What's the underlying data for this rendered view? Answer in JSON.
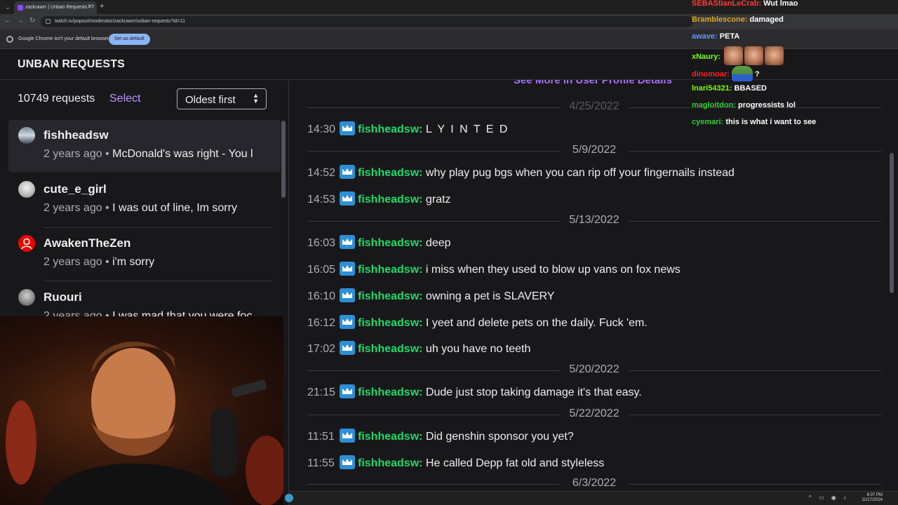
{
  "browser": {
    "tab_title": "zackrawrr | Unban Requests - T",
    "url": "twitch.tv/popout/moderator/zackrawrr/unban-requests?id=11",
    "infobar_text": "Google Chrome isn't your default browser",
    "infobar_button": "Set as default"
  },
  "page": {
    "title": "UNBAN REQUESTS"
  },
  "requests": {
    "count_label": "10749 requests",
    "select_label": "Select",
    "sort_label": "Oldest first",
    "items": [
      {
        "name": "fishheadsw",
        "time": "2 years ago",
        "separator": "•",
        "preview": "McDonald's was right - You l"
      },
      {
        "name": "cute_e_girl",
        "time": "2 years ago",
        "separator": "•",
        "preview": "I was out of line, Im sorry"
      },
      {
        "name": "AwakenTheZen",
        "time": "2 years ago",
        "separator": "•",
        "preview": "i'm sorry"
      },
      {
        "name": "Ruouri",
        "time": "2 years ago",
        "separator": "•",
        "preview": "I was mad that you were foc"
      }
    ]
  },
  "history": {
    "see_more": "See More in User Profile Details",
    "dates": [
      "4/25/2022",
      "5/9/2022",
      "5/13/2022",
      "5/20/2022",
      "5/22/2022",
      "6/3/2022"
    ],
    "messages": [
      {
        "time": "14:30",
        "user": "fishheadsw:",
        "text": "L Y I N T E D"
      },
      {
        "time": "14:52",
        "user": "fishheadsw:",
        "text": "why play pug bgs when you can rip off your fingernails instead"
      },
      {
        "time": "14:53",
        "user": "fishheadsw:",
        "text": "gratz"
      },
      {
        "time": "16:03",
        "user": "fishheadsw:",
        "text": "deep"
      },
      {
        "time": "16:05",
        "user": "fishheadsw:",
        "text": "i miss when they used to blow up vans on fox news"
      },
      {
        "time": "16:10",
        "user": "fishheadsw:",
        "text": "owning a pet is SLAVERY"
      },
      {
        "time": "16:12",
        "user": "fishheadsw:",
        "text": "I yeet and delete pets on the daily. Fuck 'em."
      },
      {
        "time": "17:02",
        "user": "fishheadsw:",
        "text": "uh you have no teeth"
      },
      {
        "time": "21:15",
        "user": "fishheadsw:",
        "text": "Dude just stop taking damage it's that easy."
      },
      {
        "time": "11:51",
        "user": "fishheadsw:",
        "text": "Did genshin sponsor you yet?"
      },
      {
        "time": "11:55",
        "user": "fishheadsw:",
        "text": "He called Depp fat old and styleless"
      }
    ]
  },
  "stream_chat": [
    {
      "user": "SEBAStianLeCrab:",
      "text": "Wut lmao",
      "color": "#ff3a3a"
    },
    {
      "user": "Bramblescone:",
      "text": "damaged",
      "color": "#daa520"
    },
    {
      "user": "awave:",
      "text": "PETA",
      "color": "#5b9bff"
    },
    {
      "user": "xNaury:",
      "text": "",
      "color": "#7cfc00"
    },
    {
      "user": "dinomoar:",
      "text": "?",
      "color": "#ff2020"
    },
    {
      "user": "lnari54321:",
      "text": "BBASED",
      "color": "#7cfc00"
    },
    {
      "user": "magloitdon:",
      "text": "progressists lol",
      "color": "#32cd32"
    },
    {
      "user": "cyemari:",
      "text": "this is what i want to see",
      "color": "#32cd32"
    }
  ],
  "taskbar": {
    "time": "6:07 PM",
    "date": "11/17/2024"
  },
  "colors": {
    "accent": "#bf94ff",
    "username": "#1fd96a",
    "mod_badge": "#2d8fd5",
    "background": "#18181b"
  }
}
